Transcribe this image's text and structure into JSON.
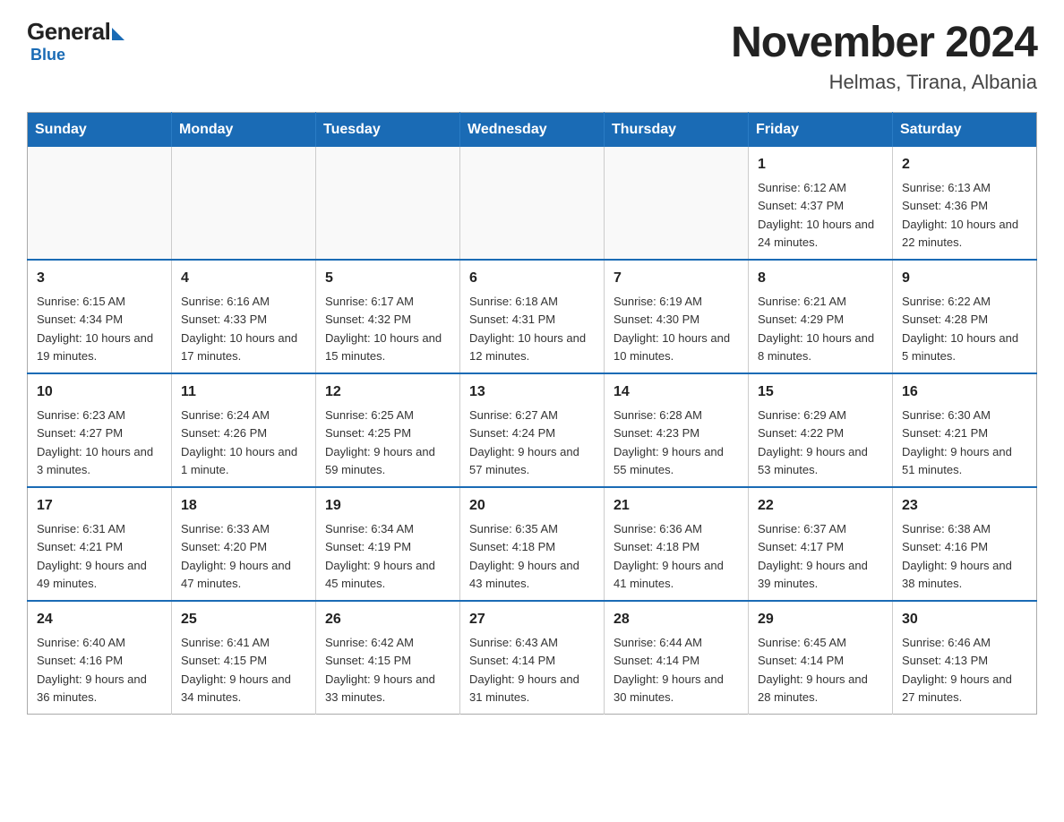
{
  "logo": {
    "general": "General",
    "blue": "Blue"
  },
  "title": "November 2024",
  "subtitle": "Helmas, Tirana, Albania",
  "days_of_week": [
    "Sunday",
    "Monday",
    "Tuesday",
    "Wednesday",
    "Thursday",
    "Friday",
    "Saturday"
  ],
  "weeks": [
    [
      {
        "day": "",
        "info": ""
      },
      {
        "day": "",
        "info": ""
      },
      {
        "day": "",
        "info": ""
      },
      {
        "day": "",
        "info": ""
      },
      {
        "day": "",
        "info": ""
      },
      {
        "day": "1",
        "info": "Sunrise: 6:12 AM\nSunset: 4:37 PM\nDaylight: 10 hours and 24 minutes."
      },
      {
        "day": "2",
        "info": "Sunrise: 6:13 AM\nSunset: 4:36 PM\nDaylight: 10 hours and 22 minutes."
      }
    ],
    [
      {
        "day": "3",
        "info": "Sunrise: 6:15 AM\nSunset: 4:34 PM\nDaylight: 10 hours and 19 minutes."
      },
      {
        "day": "4",
        "info": "Sunrise: 6:16 AM\nSunset: 4:33 PM\nDaylight: 10 hours and 17 minutes."
      },
      {
        "day": "5",
        "info": "Sunrise: 6:17 AM\nSunset: 4:32 PM\nDaylight: 10 hours and 15 minutes."
      },
      {
        "day": "6",
        "info": "Sunrise: 6:18 AM\nSunset: 4:31 PM\nDaylight: 10 hours and 12 minutes."
      },
      {
        "day": "7",
        "info": "Sunrise: 6:19 AM\nSunset: 4:30 PM\nDaylight: 10 hours and 10 minutes."
      },
      {
        "day": "8",
        "info": "Sunrise: 6:21 AM\nSunset: 4:29 PM\nDaylight: 10 hours and 8 minutes."
      },
      {
        "day": "9",
        "info": "Sunrise: 6:22 AM\nSunset: 4:28 PM\nDaylight: 10 hours and 5 minutes."
      }
    ],
    [
      {
        "day": "10",
        "info": "Sunrise: 6:23 AM\nSunset: 4:27 PM\nDaylight: 10 hours and 3 minutes."
      },
      {
        "day": "11",
        "info": "Sunrise: 6:24 AM\nSunset: 4:26 PM\nDaylight: 10 hours and 1 minute."
      },
      {
        "day": "12",
        "info": "Sunrise: 6:25 AM\nSunset: 4:25 PM\nDaylight: 9 hours and 59 minutes."
      },
      {
        "day": "13",
        "info": "Sunrise: 6:27 AM\nSunset: 4:24 PM\nDaylight: 9 hours and 57 minutes."
      },
      {
        "day": "14",
        "info": "Sunrise: 6:28 AM\nSunset: 4:23 PM\nDaylight: 9 hours and 55 minutes."
      },
      {
        "day": "15",
        "info": "Sunrise: 6:29 AM\nSunset: 4:22 PM\nDaylight: 9 hours and 53 minutes."
      },
      {
        "day": "16",
        "info": "Sunrise: 6:30 AM\nSunset: 4:21 PM\nDaylight: 9 hours and 51 minutes."
      }
    ],
    [
      {
        "day": "17",
        "info": "Sunrise: 6:31 AM\nSunset: 4:21 PM\nDaylight: 9 hours and 49 minutes."
      },
      {
        "day": "18",
        "info": "Sunrise: 6:33 AM\nSunset: 4:20 PM\nDaylight: 9 hours and 47 minutes."
      },
      {
        "day": "19",
        "info": "Sunrise: 6:34 AM\nSunset: 4:19 PM\nDaylight: 9 hours and 45 minutes."
      },
      {
        "day": "20",
        "info": "Sunrise: 6:35 AM\nSunset: 4:18 PM\nDaylight: 9 hours and 43 minutes."
      },
      {
        "day": "21",
        "info": "Sunrise: 6:36 AM\nSunset: 4:18 PM\nDaylight: 9 hours and 41 minutes."
      },
      {
        "day": "22",
        "info": "Sunrise: 6:37 AM\nSunset: 4:17 PM\nDaylight: 9 hours and 39 minutes."
      },
      {
        "day": "23",
        "info": "Sunrise: 6:38 AM\nSunset: 4:16 PM\nDaylight: 9 hours and 38 minutes."
      }
    ],
    [
      {
        "day": "24",
        "info": "Sunrise: 6:40 AM\nSunset: 4:16 PM\nDaylight: 9 hours and 36 minutes."
      },
      {
        "day": "25",
        "info": "Sunrise: 6:41 AM\nSunset: 4:15 PM\nDaylight: 9 hours and 34 minutes."
      },
      {
        "day": "26",
        "info": "Sunrise: 6:42 AM\nSunset: 4:15 PM\nDaylight: 9 hours and 33 minutes."
      },
      {
        "day": "27",
        "info": "Sunrise: 6:43 AM\nSunset: 4:14 PM\nDaylight: 9 hours and 31 minutes."
      },
      {
        "day": "28",
        "info": "Sunrise: 6:44 AM\nSunset: 4:14 PM\nDaylight: 9 hours and 30 minutes."
      },
      {
        "day": "29",
        "info": "Sunrise: 6:45 AM\nSunset: 4:14 PM\nDaylight: 9 hours and 28 minutes."
      },
      {
        "day": "30",
        "info": "Sunrise: 6:46 AM\nSunset: 4:13 PM\nDaylight: 9 hours and 27 minutes."
      }
    ]
  ]
}
